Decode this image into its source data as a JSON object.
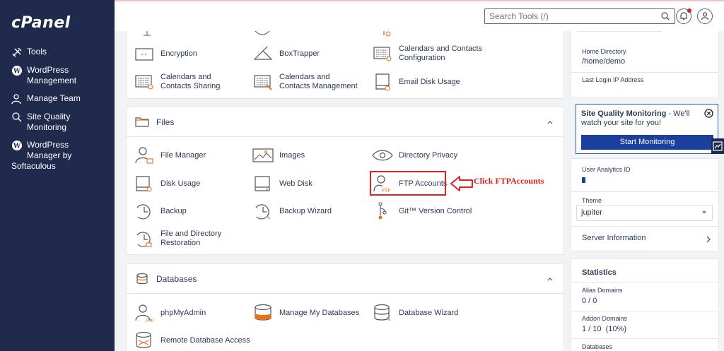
{
  "app": {
    "logo": "cPanel"
  },
  "search": {
    "placeholder": "Search Tools (/)"
  },
  "sidebar": {
    "items": [
      {
        "label": "Tools",
        "icon": "tools-icon"
      },
      {
        "label": "WordPress Management",
        "icon": "wordpress-icon"
      },
      {
        "label": "Manage Team",
        "icon": "team-icon"
      },
      {
        "label": "Site Quality Monitoring",
        "icon": "site-quality-icon"
      },
      {
        "label": "WordPress Manager by",
        "icon": "wordpress-icon"
      },
      {
        "label": "Softaculous",
        "icon": ""
      }
    ]
  },
  "security": {
    "items": [
      {
        "label": "Encryption",
        "icon": "encryption-icon"
      },
      {
        "label": "BoxTrapper",
        "icon": "boxtrapper-icon"
      },
      {
        "label": "Calendars and Contacts Configuration",
        "icon": "calendar-config-icon"
      },
      {
        "label": "Calendars and Contacts Sharing",
        "icon": "calendar-sharing-icon"
      },
      {
        "label": "Calendars and Contacts Management",
        "icon": "calendar-management-icon"
      },
      {
        "label": "Email Disk Usage",
        "icon": "email-disk-icon"
      }
    ]
  },
  "files": {
    "title": "Files",
    "items": [
      {
        "label": "File Manager",
        "icon": "file-manager-icon"
      },
      {
        "label": "Images",
        "icon": "images-icon"
      },
      {
        "label": "Directory Privacy",
        "icon": "directory-privacy-icon"
      },
      {
        "label": "Disk Usage",
        "icon": "disk-usage-icon"
      },
      {
        "label": "Web Disk",
        "icon": "web-disk-icon"
      },
      {
        "label": "FTP Accounts",
        "icon": "ftp-icon"
      },
      {
        "label": "Backup",
        "icon": "backup-icon"
      },
      {
        "label": "Backup Wizard",
        "icon": "backup-wizard-icon"
      },
      {
        "label": "Git™ Version Control",
        "icon": "git-icon"
      },
      {
        "label": "File and Directory Restoration",
        "icon": "restore-icon"
      }
    ]
  },
  "databases": {
    "title": "Databases",
    "items": [
      {
        "label": "phpMyAdmin",
        "icon": "phpmyadmin-icon"
      },
      {
        "label": "Manage My Databases",
        "icon": "database-icon"
      },
      {
        "label": "Database Wizard",
        "icon": "database-wizard-icon"
      },
      {
        "label": "Remote Database Access",
        "icon": "remote-db-icon"
      }
    ]
  },
  "info": {
    "home_dir_label": "Home Directory",
    "home_dir_value": "/home/demo",
    "last_login_label": "Last Login IP Address"
  },
  "sqm": {
    "title": "Site Quality Monitoring",
    "text": " - We'll watch your site for you!",
    "button": "Start Monitoring"
  },
  "analytics": {
    "user_analytics_label": "User Analytics ID",
    "theme_label": "Theme",
    "theme_value": "jupiter",
    "server_info": "Server Information"
  },
  "stats": {
    "title": "Statistics",
    "alias_label": "Alias Domains",
    "alias_value": "0 / 0",
    "addon_label": "Addon Domains",
    "addon_value": "1 / 10  (10%)",
    "db_label": "Databases"
  },
  "annotation": {
    "text": "Click FTPAccounts",
    "color": "#d62020"
  },
  "colors": {
    "sidebar": "#1f2a4d",
    "accent": "#1a3f9c",
    "highlight": "#e02222"
  }
}
